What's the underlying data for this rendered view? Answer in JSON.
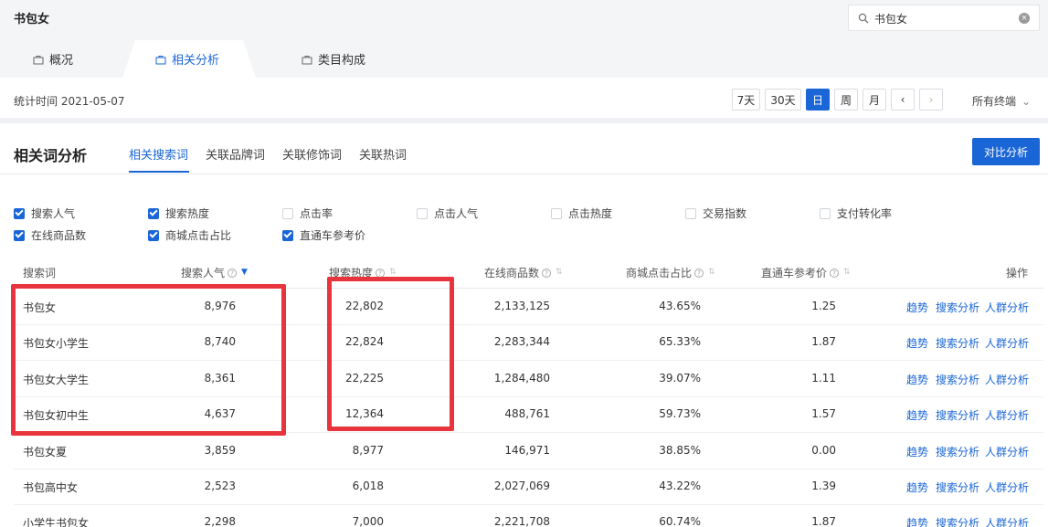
{
  "header": {
    "title": "书包女",
    "search_value": "书包女"
  },
  "main_tabs": [
    {
      "label": "概况",
      "active": false
    },
    {
      "label": "相关分析",
      "active": true
    },
    {
      "label": "类目构成",
      "active": false
    }
  ],
  "stat": {
    "label": "统计时间 2021-05-07",
    "periods": [
      "7天",
      "30天",
      "日",
      "周",
      "月"
    ],
    "active_period": "日",
    "terminal": "所有终端"
  },
  "panel": {
    "title": "相关词分析",
    "sub_tabs": [
      "相关搜索词",
      "关联品牌词",
      "关联修饰词",
      "关联热词"
    ],
    "compare_button": "对比分析"
  },
  "metrics": [
    {
      "label": "搜索人气",
      "checked": true
    },
    {
      "label": "搜索热度",
      "checked": true
    },
    {
      "label": "点击率",
      "checked": false
    },
    {
      "label": "点击人气",
      "checked": false
    },
    {
      "label": "点击热度",
      "checked": false
    },
    {
      "label": "交易指数",
      "checked": false
    },
    {
      "label": "支付转化率",
      "checked": false
    },
    {
      "label": "在线商品数",
      "checked": true
    },
    {
      "label": "商城点击占比",
      "checked": true
    },
    {
      "label": "直通车参考价",
      "checked": true
    }
  ],
  "table": {
    "columns": [
      "搜索词",
      "搜索人气",
      "搜索热度",
      "在线商品数",
      "商城点击占比",
      "直通车参考价",
      "操作"
    ],
    "actions": [
      "趋势",
      "搜索分析",
      "人群分析"
    ],
    "rows": [
      [
        "书包女",
        "8,976",
        "22,802",
        "2,133,125",
        "43.65%",
        "1.25"
      ],
      [
        "书包女小学生",
        "8,740",
        "22,824",
        "2,283,344",
        "65.33%",
        "1.87"
      ],
      [
        "书包女大学生",
        "8,361",
        "22,225",
        "1,284,480",
        "39.07%",
        "1.11"
      ],
      [
        "书包女初中生",
        "4,637",
        "12,364",
        "488,761",
        "59.73%",
        "1.57"
      ],
      [
        "书包女夏",
        "3,859",
        "8,977",
        "146,971",
        "38.85%",
        "0.00"
      ],
      [
        "书包高中女",
        "2,523",
        "6,018",
        "2,027,069",
        "43.22%",
        "1.39"
      ],
      [
        "小学生书包女",
        "2,298",
        "7,000",
        "2,221,708",
        "60.74%",
        "1.87"
      ]
    ]
  },
  "colors": {
    "accent": "#1a66d6",
    "highlight": "#e8343c"
  }
}
